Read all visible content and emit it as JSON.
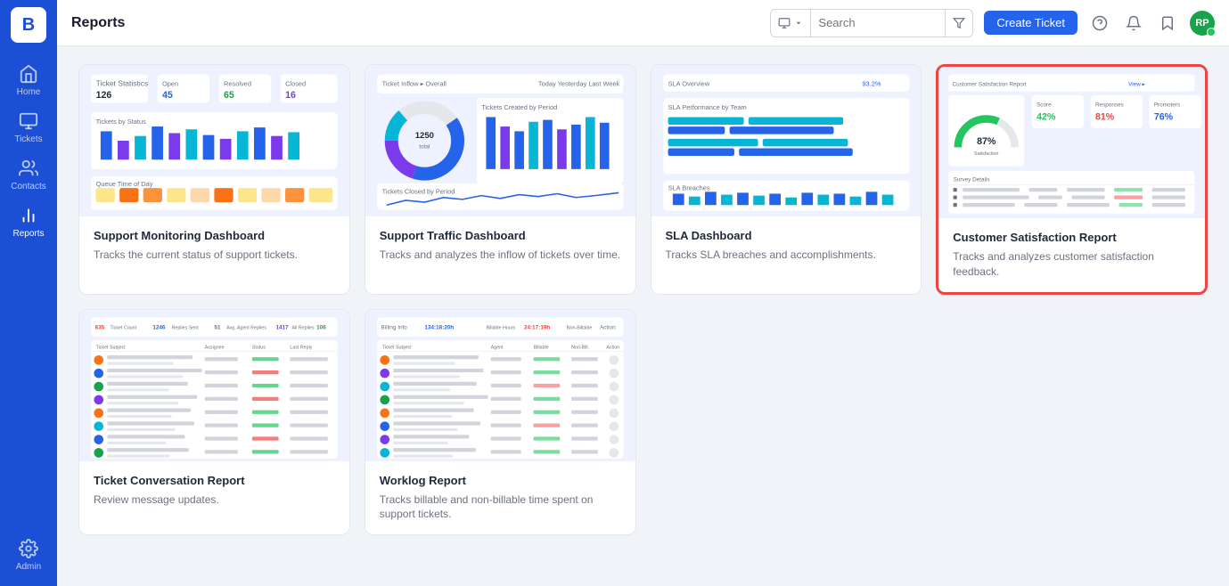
{
  "sidebar": {
    "logo": "B",
    "items": [
      {
        "id": "home",
        "label": "Home",
        "icon": "home"
      },
      {
        "id": "tickets",
        "label": "Tickets",
        "icon": "tickets"
      },
      {
        "id": "contacts",
        "label": "Contacts",
        "icon": "contacts"
      },
      {
        "id": "reports",
        "label": "Reports",
        "icon": "reports",
        "active": true
      },
      {
        "id": "admin",
        "label": "Admin",
        "icon": "admin"
      }
    ]
  },
  "header": {
    "title": "Reports",
    "search_placeholder": "Search",
    "create_ticket_label": "Create Ticket"
  },
  "reports": [
    {
      "id": "support-monitoring",
      "title": "Support Monitoring Dashboard",
      "description": "Tracks the current status of support tickets.",
      "highlighted": false
    },
    {
      "id": "support-traffic",
      "title": "Support Traffic Dashboard",
      "description": "Tracks and analyzes the inflow of tickets over time.",
      "highlighted": false
    },
    {
      "id": "sla-dashboard",
      "title": "SLA Dashboard",
      "description": "Tracks SLA breaches and accomplishments.",
      "highlighted": false
    },
    {
      "id": "customer-satisfaction",
      "title": "Customer Satisfaction Report",
      "description": "Tracks and analyzes customer satisfaction feedback.",
      "highlighted": true
    },
    {
      "id": "ticket-conversation",
      "title": "Ticket Conversation Report",
      "description": "Review message updates.",
      "highlighted": false
    },
    {
      "id": "worklog",
      "title": "Worklog Report",
      "description": "Tracks billable and non-billable time spent on support tickets.",
      "highlighted": false
    }
  ],
  "avatar": {
    "initials": "RP",
    "color": "#16a34a"
  }
}
